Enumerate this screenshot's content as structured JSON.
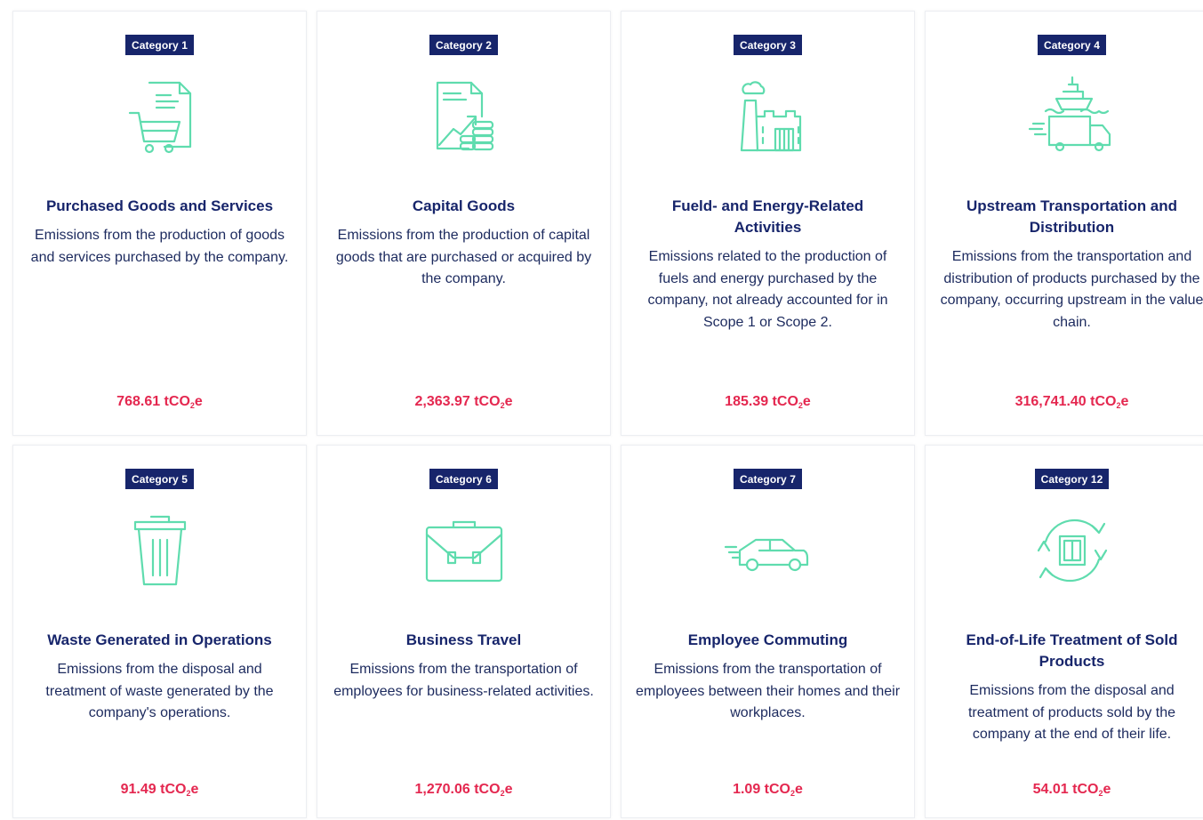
{
  "cards": [
    {
      "badge": "Category 1",
      "icon": "cart-document-icon",
      "title": "Purchased Goods and Services",
      "desc": "Emissions from the production of goods and services purchased by the company.",
      "value": "768.61 tCO",
      "value_sub": "2",
      "value_suffix": "e"
    },
    {
      "badge": "Category 2",
      "icon": "document-growth-coins-icon",
      "title": "Capital Goods",
      "desc": "Emissions from the production of capital goods that are purchased or acquired by the company.",
      "value": "2,363.97 tCO",
      "value_sub": "2",
      "value_suffix": "e"
    },
    {
      "badge": "Category 3",
      "icon": "factory-icon",
      "title": "Fueld- and Energy-Related Activities",
      "desc": "Emissions related to the production of fuels and energy purchased by the company, not already accounted for in Scope 1 or Scope 2.",
      "value": "185.39 tCO",
      "value_sub": "2",
      "value_suffix": "e"
    },
    {
      "badge": "Category 4",
      "icon": "ship-truck-icon",
      "title": "Upstream Transportation and Distribution",
      "desc": "Emissions from the transportation and distribution of products purchased by the company, occurring upstream in the value chain.",
      "value": "316,741.40 tCO",
      "value_sub": "2",
      "value_suffix": "e"
    },
    {
      "badge": "Category 5",
      "icon": "trash-bin-icon",
      "title": "Waste Generated in Operations",
      "desc": "Emissions from the disposal and treatment of waste generated by the company's operations.",
      "value": "91.49 tCO",
      "value_sub": "2",
      "value_suffix": "e"
    },
    {
      "badge": "Category 6",
      "icon": "briefcase-icon",
      "title": "Business Travel",
      "desc": "Emissions from the transportation of employees for business-related activities.",
      "value": "1,270.06 tCO",
      "value_sub": "2",
      "value_suffix": "e"
    },
    {
      "badge": "Category 7",
      "icon": "car-icon",
      "title": "Employee Commuting",
      "desc": "Emissions from the transportation of employees between their homes and their workplaces.",
      "value": "1.09 tCO",
      "value_sub": "2",
      "value_suffix": "e"
    },
    {
      "badge": "Category 12",
      "icon": "recycle-box-icon",
      "title": "End-of-Life Treatment of Sold Products",
      "desc": "Emissions from the disposal and treatment of products sold by the company at the end of their life.",
      "value": "54.01 tCO",
      "value_sub": "2",
      "value_suffix": "e"
    }
  ],
  "colors": {
    "badge": "#17256b",
    "title": "#17256b",
    "icon": "#5fdcae",
    "value": "#e4274f"
  }
}
